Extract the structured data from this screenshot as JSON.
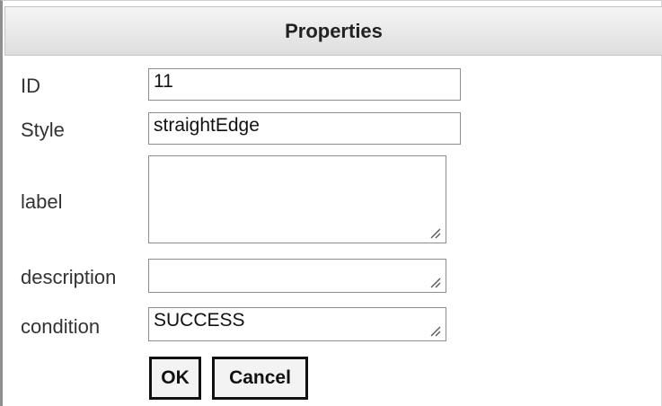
{
  "dialog": {
    "title": "Properties"
  },
  "fields": {
    "id": {
      "label": "ID",
      "value": "11"
    },
    "style": {
      "label": "Style",
      "value": "straightEdge"
    },
    "label": {
      "label": "label",
      "value": ""
    },
    "description": {
      "label": "description",
      "value": ""
    },
    "condition": {
      "label": "condition",
      "value": "SUCCESS"
    }
  },
  "buttons": {
    "ok": "OK",
    "cancel": "Cancel"
  },
  "icons": {
    "resize": "resize-grip-icon"
  },
  "colors": {
    "header_bg": "#e4e4e4",
    "border": "#8d8d8d",
    "button_border": "#111111"
  }
}
